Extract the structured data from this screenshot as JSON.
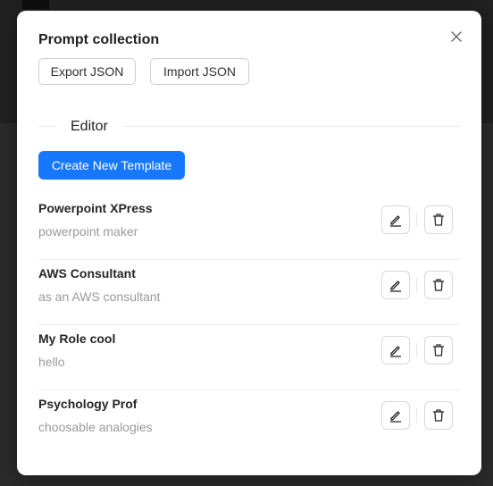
{
  "modal": {
    "title": "Prompt collection",
    "export_label": "Export JSON",
    "import_label": "Import JSON",
    "section_label": "Editor",
    "create_label": "Create New Template"
  },
  "templates": [
    {
      "name": "Powerpoint XPress",
      "description": "powerpoint maker"
    },
    {
      "name": "AWS Consultant",
      "description": "as an AWS consultant"
    },
    {
      "name": "My Role cool",
      "description": "hello"
    },
    {
      "name": "Psychology Prof",
      "description": "choosable analogies"
    }
  ],
  "colors": {
    "primary": "#1677ff",
    "backdrop": "#2b2b2b",
    "modal_bg": "#ffffff"
  }
}
